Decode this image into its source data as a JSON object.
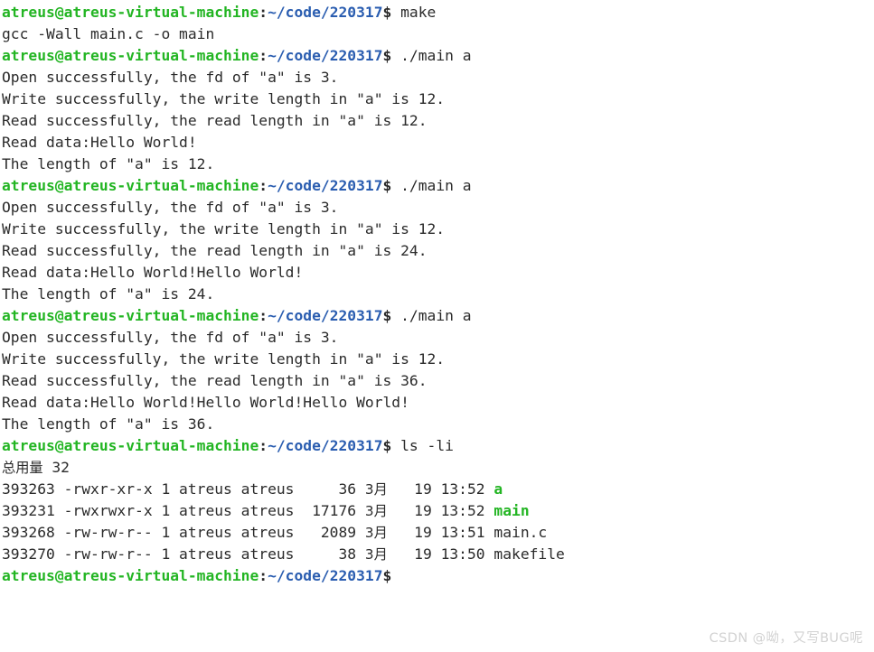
{
  "terminal": {
    "background_color": "#ffffff",
    "foreground_color": "#2b2b2b",
    "prompt_user_color": "#23b523",
    "prompt_path_color": "#2a5db0",
    "executable_color": "#23b523",
    "prompt": {
      "user_host": "atreus@atreus-virtual-machine",
      "separator": ":",
      "path": "~/code/220317",
      "symbol": "$"
    },
    "lines": [
      {
        "type": "prompt",
        "command": " make"
      },
      {
        "type": "output",
        "text": "gcc -Wall main.c -o main"
      },
      {
        "type": "prompt",
        "command": " ./main a"
      },
      {
        "type": "output",
        "text": "Open successfully, the fd of \"a\" is 3."
      },
      {
        "type": "output",
        "text": "Write successfully, the write length in \"a\" is 12."
      },
      {
        "type": "output",
        "text": "Read successfully, the read length in \"a\" is 12."
      },
      {
        "type": "output",
        "text": "Read data:Hello World!"
      },
      {
        "type": "output",
        "text": "The length of \"a\" is 12."
      },
      {
        "type": "prompt",
        "command": " ./main a"
      },
      {
        "type": "output",
        "text": "Open successfully, the fd of \"a\" is 3."
      },
      {
        "type": "output",
        "text": "Write successfully, the write length in \"a\" is 12."
      },
      {
        "type": "output",
        "text": "Read successfully, the read length in \"a\" is 24."
      },
      {
        "type": "output",
        "text": "Read data:Hello World!Hello World!"
      },
      {
        "type": "output",
        "text": "The length of \"a\" is 24."
      },
      {
        "type": "prompt",
        "command": " ./main a"
      },
      {
        "type": "output",
        "text": "Open successfully, the fd of \"a\" is 3."
      },
      {
        "type": "output",
        "text": "Write successfully, the write length in \"a\" is 12."
      },
      {
        "type": "output",
        "text": "Read successfully, the read length in \"a\" is 36."
      },
      {
        "type": "output",
        "text": "Read data:Hello World!Hello World!Hello World!"
      },
      {
        "type": "output",
        "text": "The length of \"a\" is 36."
      },
      {
        "type": "prompt",
        "command": " ls -li"
      },
      {
        "type": "output",
        "text": "总用量 32"
      },
      {
        "type": "ls",
        "inode": "393263",
        "perms": "-rwxr-xr-x",
        "links": "1",
        "owner": "atreus",
        "group": "atreus",
        "size": "36",
        "month": "3月",
        "day": "19",
        "time": "13:52",
        "name": "a",
        "name_class": "exe"
      },
      {
        "type": "ls",
        "inode": "393231",
        "perms": "-rwxrwxr-x",
        "links": "1",
        "owner": "atreus",
        "group": "atreus",
        "size": "17176",
        "month": "3月",
        "day": "19",
        "time": "13:52",
        "name": "main",
        "name_class": "exe"
      },
      {
        "type": "ls",
        "inode": "393268",
        "perms": "-rw-rw-r--",
        "links": "1",
        "owner": "atreus",
        "group": "atreus",
        "size": "2089",
        "month": "3月",
        "day": "19",
        "time": "13:51",
        "name": "main.c",
        "name_class": "plain"
      },
      {
        "type": "ls",
        "inode": "393270",
        "perms": "-rw-rw-r--",
        "links": "1",
        "owner": "atreus",
        "group": "atreus",
        "size": "38",
        "month": "3月",
        "day": "19",
        "time": "13:50",
        "name": "makefile",
        "name_class": "plain"
      },
      {
        "type": "prompt",
        "command": ""
      }
    ]
  },
  "watermark": {
    "text": "CSDN @呦，又写BUG呢",
    "color": "#d2d2d2"
  }
}
